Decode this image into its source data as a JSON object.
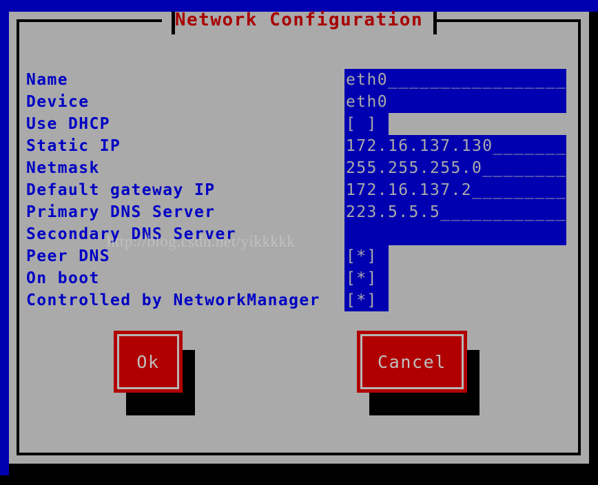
{
  "terminal": {
    "background_color": "#0000b0",
    "screen_color": "#000000"
  },
  "dialog": {
    "title": "Network Configuration",
    "title_color": "#a80000",
    "background_color": "#aaaaaa",
    "border_color": "#000000",
    "label_color": "#0000c4",
    "field_background": "#0000b0",
    "field_text_color": "#aaaaaa"
  },
  "form": {
    "rows": [
      {
        "label": "Name",
        "value": "eth0_______________________",
        "type": "text"
      },
      {
        "label": "Device",
        "value": "eth0",
        "type": "text"
      },
      {
        "label": "Use DHCP",
        "value": "[ ]",
        "type": "checkbox"
      },
      {
        "label": "Static IP",
        "value": "172.16.137.130________",
        "type": "text"
      },
      {
        "label": "Netmask",
        "value": "255.255.255.0__________",
        "type": "text"
      },
      {
        "label": "Default gateway IP",
        "value": "172.16.137.2___________",
        "type": "text"
      },
      {
        "label": "Primary DNS Server",
        "value": "223.5.5.5______________",
        "type": "text"
      },
      {
        "label": "Secondary DNS Server",
        "value": "",
        "type": "text"
      },
      {
        "label": "Peer DNS",
        "value": "[*]",
        "type": "checkbox"
      },
      {
        "label": "On boot",
        "value": "[*]",
        "type": "checkbox"
      },
      {
        "label": "Controlled by NetworkManager",
        "value": "[*]",
        "type": "checkbox"
      }
    ]
  },
  "buttons": {
    "ok_label": "Ok",
    "cancel_label": "Cancel",
    "face_color": "#b00000",
    "text_color": "#c0c0c0"
  },
  "watermark": {
    "text": "http://blog.csdn.net/yikkkkk"
  }
}
